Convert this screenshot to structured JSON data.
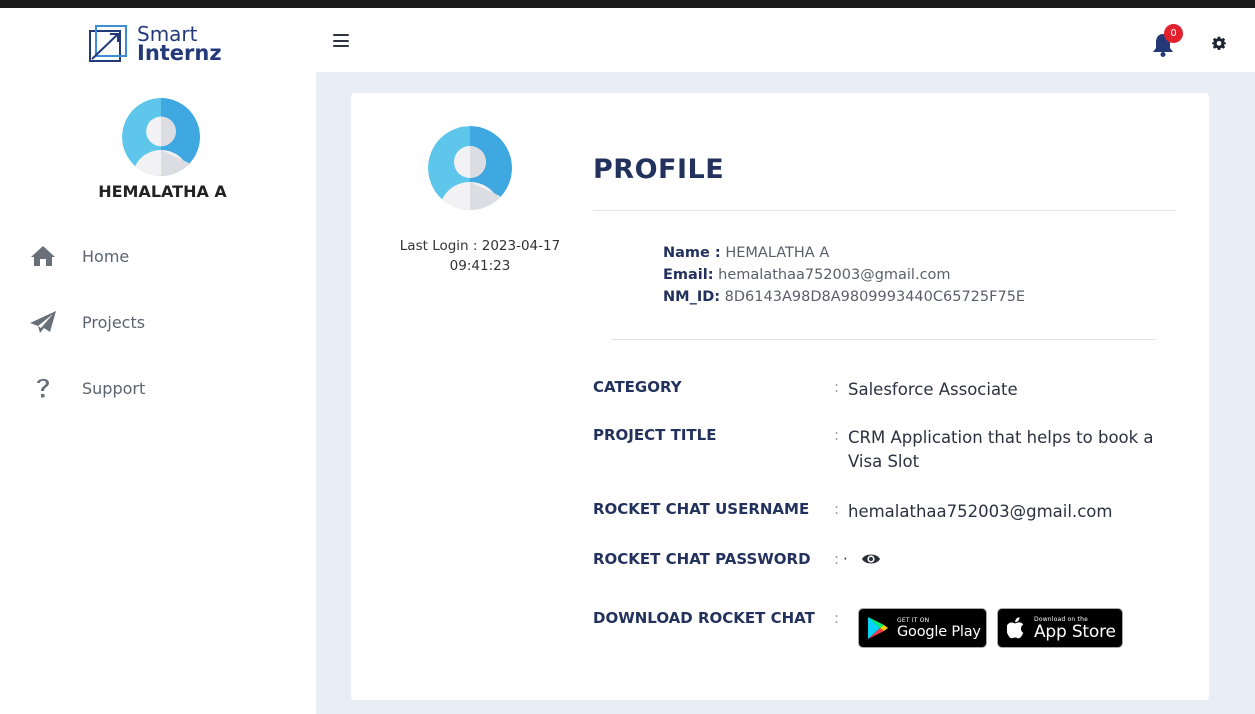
{
  "brand": {
    "line1": "Smart",
    "line2": "Internz"
  },
  "sidebar": {
    "user_name": "HEMALATHA A",
    "items": [
      {
        "label": "Home",
        "icon": "home-icon"
      },
      {
        "label": "Projects",
        "icon": "paper-plane-icon"
      },
      {
        "label": "Support",
        "icon": "question-icon"
      }
    ]
  },
  "header": {
    "notification_count": "0"
  },
  "profile": {
    "last_login": "Last Login : 2023-04-17 09:41:23",
    "title": "PROFILE",
    "name_label": "Name :",
    "name_value": "HEMALATHA A",
    "email_label": "Email:",
    "email_value": "hemalathaa752003@gmail.com",
    "nmid_label": "NM_ID:",
    "nmid_value": "8D6143A98D8A9809993440C65725F75E",
    "category_label": "CATEGORY",
    "category_value": "Salesforce Associate",
    "project_title_label": "PROJECT TITLE",
    "project_title_value": "CRM Application that helps to book a Visa Slot",
    "rc_username_label": "ROCKET CHAT USERNAME",
    "rc_username_value": "hemalathaa752003@gmail.com",
    "rc_password_label": "ROCKET CHAT PASSWORD",
    "rc_password_value": "·",
    "download_label": "DOWNLOAD ROCKET CHAT",
    "colon": ":",
    "google_play": {
      "small": "GET IT ON",
      "big": "Google Play"
    },
    "app_store": {
      "small": "Download on the",
      "big": "App Store"
    }
  },
  "colors": {
    "brand": "#243a78",
    "background": "#e9edf5",
    "badge": "#e3202c",
    "avatar": "#3fa8e0"
  }
}
